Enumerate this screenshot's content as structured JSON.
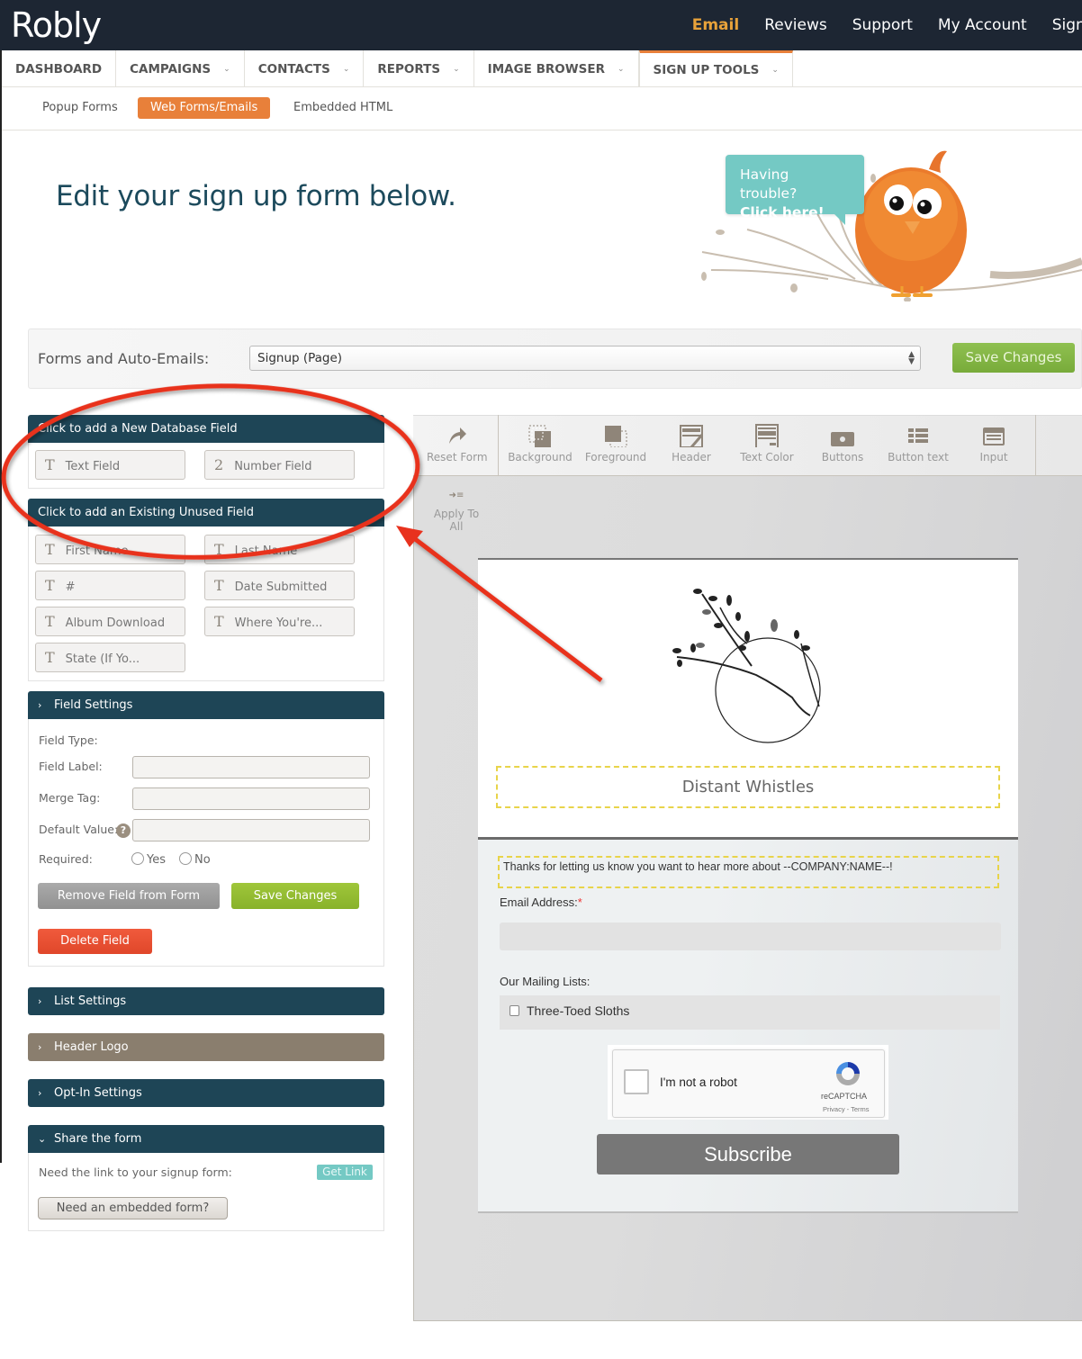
{
  "app": {
    "logo": "Robly"
  },
  "topnav": [
    {
      "label": "Email",
      "active": true
    },
    {
      "label": "Reviews"
    },
    {
      "label": "Support"
    },
    {
      "label": "My Account"
    },
    {
      "label": "Sign Out"
    }
  ],
  "tabs": [
    {
      "label": "DASHBOARD",
      "dropdown": false
    },
    {
      "label": "CAMPAIGNS",
      "dropdown": true
    },
    {
      "label": "CONTACTS",
      "dropdown": true
    },
    {
      "label": "REPORTS",
      "dropdown": true
    },
    {
      "label": "IMAGE BROWSER",
      "dropdown": true
    },
    {
      "label": "SIGN UP TOOLS",
      "dropdown": true,
      "active": true
    }
  ],
  "subtabs": [
    {
      "label": "Popup Forms"
    },
    {
      "label": "Web Forms/Emails",
      "active": true
    },
    {
      "label": "Embedded HTML"
    }
  ],
  "page_title": "Edit your sign up form below.",
  "help": {
    "line1": "Having trouble?",
    "line2": "Click here!"
  },
  "forms_bar": {
    "label": "Forms and Auto-Emails:",
    "selected": "Signup (Page)",
    "save_label": "Save Changes"
  },
  "new_fields": {
    "title": "Click to add a New Database Field",
    "items": [
      {
        "icon": "T",
        "label": "Text Field"
      },
      {
        "icon": "2",
        "label": "Number Field"
      }
    ]
  },
  "existing_fields": {
    "title": "Click to add an Existing Unused Field",
    "items": [
      {
        "icon": "T",
        "label": "First Name"
      },
      {
        "icon": "T",
        "label": "Last Name"
      },
      {
        "icon": "T",
        "label": "#"
      },
      {
        "icon": "T",
        "label": "Date Submitted"
      },
      {
        "icon": "T",
        "label": "Album Download"
      },
      {
        "icon": "T",
        "label": "Where You're..."
      },
      {
        "icon": "T",
        "label": "State (If Yo..."
      }
    ]
  },
  "field_settings": {
    "title": "Field Settings",
    "type_label": "Field Type:",
    "label_label": "Field Label:",
    "label_value": "",
    "merge_label": "Merge Tag:",
    "merge_value": "",
    "default_label": "Default Value:",
    "default_value": "",
    "help_glyph": "?",
    "required_label": "Required:",
    "yes": "Yes",
    "no": "No",
    "remove_btn": "Remove Field from Form",
    "save_btn": "Save Changes",
    "delete_btn": "Delete Field"
  },
  "collapsed_panels": [
    {
      "title": "List Settings"
    },
    {
      "title": "Header Logo"
    },
    {
      "title": "Opt-In Settings"
    }
  ],
  "share": {
    "title": "Share the form",
    "link_text": "Need the link to your signup form:",
    "get_link": "Get Link",
    "embed_btn": "Need an embedded form?"
  },
  "toolbar": [
    {
      "label": "Reset Form",
      "icon": "redo-arrow-icon"
    },
    {
      "label": "Background",
      "icon": "background-icon"
    },
    {
      "label": "Foreground",
      "icon": "foreground-icon"
    },
    {
      "label": "Header",
      "icon": "header-icon"
    },
    {
      "label": "Text Color",
      "icon": "text-color-icon"
    },
    {
      "label": "Buttons",
      "icon": "buttons-icon"
    },
    {
      "label": "Button text",
      "icon": "button-text-icon"
    },
    {
      "label": "Input",
      "icon": "input-icon"
    }
  ],
  "apply_all": "Apply To All",
  "preview": {
    "header_text": "Distant Whistles",
    "thanks": "Thanks for letting us know you want to hear more about --COMPANY:NAME--!",
    "email_label": "Email Address:",
    "required_mark": "*",
    "email_value": "",
    "lists_label": "Our Mailing Lists:",
    "list_item": "Three-Toed Sloths",
    "captcha_text": "I'm not a robot",
    "captcha_brand": "reCAPTCHA",
    "captcha_links": "Privacy - Terms",
    "subscribe": "Subscribe"
  },
  "colors": {
    "topbar": "#1d2633",
    "accent_orange": "#e8803a",
    "panel_header": "#1e4556",
    "teal": "#74c9c4",
    "green": "#88b22a",
    "annotation_red": "#e8321e"
  }
}
